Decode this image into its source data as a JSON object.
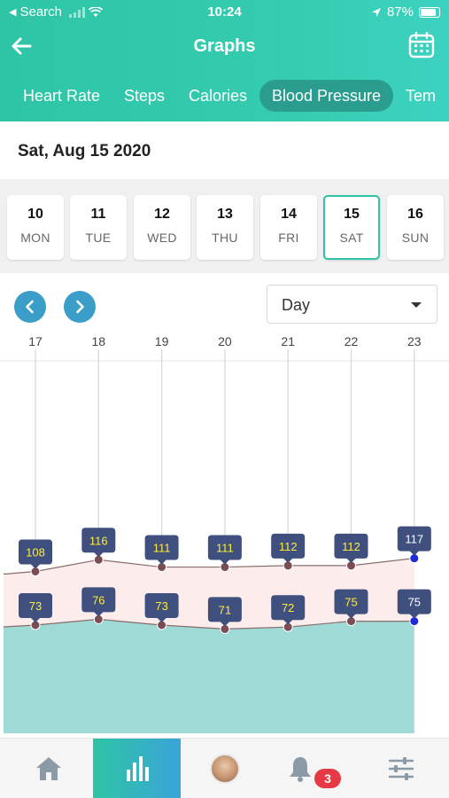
{
  "status_bar": {
    "back_app": "Search",
    "time": "10:24",
    "battery": "87%"
  },
  "nav": {
    "title": "Graphs"
  },
  "tabs": [
    {
      "label": "Heart Rate"
    },
    {
      "label": "Steps"
    },
    {
      "label": "Calories"
    },
    {
      "label": "Blood Pressure",
      "active": true
    },
    {
      "label": "Tem"
    }
  ],
  "date_title": "Sat, Aug 15 2020",
  "days": [
    {
      "num": "10",
      "dow": "MON"
    },
    {
      "num": "11",
      "dow": "TUE"
    },
    {
      "num": "12",
      "dow": "WED"
    },
    {
      "num": "13",
      "dow": "THU"
    },
    {
      "num": "14",
      "dow": "FRI"
    },
    {
      "num": "15",
      "dow": "SAT",
      "active": true
    },
    {
      "num": "16",
      "dow": "SUN"
    }
  ],
  "period_select": {
    "value": "Day"
  },
  "chart_data": {
    "type": "area",
    "x": [
      "17",
      "18",
      "19",
      "20",
      "21",
      "22",
      "23"
    ],
    "series": [
      {
        "values": [
          108,
          116,
          111,
          111,
          112,
          112,
          117
        ]
      },
      {
        "values": [
          73,
          76,
          73,
          71,
          72,
          75,
          75
        ]
      }
    ],
    "colors": {
      "upper_fill": "#fdecec",
      "lower_fill": "#9fdad6",
      "line": "#8a6b6b",
      "point": "#7a4d55",
      "last_point": "#1f2bd8",
      "label_bg": "#3f4f7e",
      "label_text": "#ffec3d"
    }
  },
  "tabbar": {
    "items": [
      "home",
      "graphs",
      "profile",
      "notifications",
      "settings"
    ],
    "notification_count": "3"
  }
}
